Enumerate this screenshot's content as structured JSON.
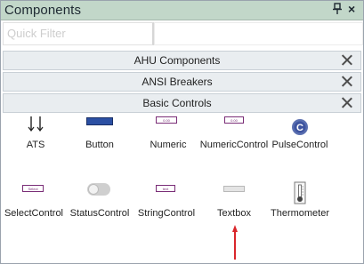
{
  "window": {
    "title": "Components",
    "pin_glyph": "↑",
    "close_glyph": "×"
  },
  "filter": {
    "placeholder": "Quick Filter"
  },
  "categories": [
    {
      "label": "AHU Components"
    },
    {
      "label": "ANSI Breakers"
    },
    {
      "label": "Basic Controls"
    }
  ],
  "items": [
    {
      "label": "ATS",
      "icon": "ats-icon"
    },
    {
      "label": "Button",
      "icon": "button-icon"
    },
    {
      "label": "Numeric",
      "icon": "numeric-icon"
    },
    {
      "label": "NumericControl",
      "icon": "numeric-control-icon"
    },
    {
      "label": "PulseControl",
      "icon": "pulse-control-icon"
    },
    {
      "label": "SelectControl",
      "icon": "select-control-icon"
    },
    {
      "label": "StatusControl",
      "icon": "status-control-icon"
    },
    {
      "label": "StringControl",
      "icon": "string-control-icon"
    },
    {
      "label": "Textbox",
      "icon": "textbox-icon"
    },
    {
      "label": "Thermometer",
      "icon": "thermometer-icon"
    }
  ],
  "annotation": {
    "arrow_color": "#d9262b"
  }
}
